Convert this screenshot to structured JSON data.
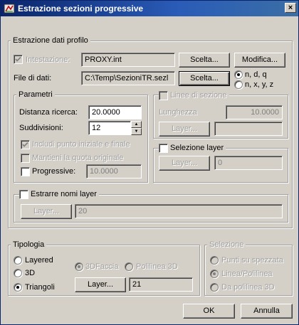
{
  "window": {
    "title": "Estrazione sezioni progressive",
    "close_glyph": "×"
  },
  "profile_group": {
    "label": "Estrazione dati profilo",
    "header_checkbox_label": "Intestazione:",
    "header_checked": true,
    "header_value": "PROXY.int",
    "header_choose_button": "Scelta...",
    "modify_button": "Modifica...",
    "data_file_label": "File di dati:",
    "data_file_value": "C:\\Temp\\SezioniTR.sezl",
    "data_file_choose_button": "Scelta...",
    "format_options": [
      {
        "label": "n, d, q",
        "selected": true
      },
      {
        "label": "n, x, y, z",
        "selected": false
      }
    ]
  },
  "params_group": {
    "label": "Parametri",
    "search_distance_label": "Distanza ricerca:",
    "search_distance_value": "20.0000",
    "subdivisions_label": "Suddivisioni:",
    "subdivisions_value": "12",
    "include_endpoints_label": "Includi punto iniziale e finale",
    "include_endpoints_checked": true,
    "keep_elevation_label": "Mantieni la quota originale",
    "keep_elevation_checked": false,
    "progressive_label": "Progressive:",
    "progressive_checked": false,
    "progressive_value": "10.0000"
  },
  "section_lines": {
    "checkbox_label": "Linee di sezione",
    "checked": false,
    "length_label": "Lunghezza",
    "length_value": "10.0000",
    "layer_button": "Layer...",
    "layer_value": ""
  },
  "layer_selection": {
    "checkbox_label": "Selezione layer",
    "checked": false,
    "layer_button": "Layer...",
    "layer_value": "0"
  },
  "extract_layer_names": {
    "checkbox_label": "Estrarre nomi layer",
    "checked": false,
    "layer_button": "Layer...",
    "layer_value": "20"
  },
  "typology_group": {
    "label": "Tipologia",
    "options": [
      {
        "label": "Layered",
        "selected": false
      },
      {
        "label": "3D",
        "selected": false
      },
      {
        "label": "Triangoli",
        "selected": true
      }
    ],
    "sub_options": [
      {
        "label": "3DFaccia",
        "selected": true
      },
      {
        "label": "Polilinea 3D",
        "selected": false
      }
    ],
    "layer_button": "Layer...",
    "layer_value": "21"
  },
  "selection_group": {
    "label": "Selezione",
    "options": [
      {
        "label": "Punti su spezzata",
        "selected": false
      },
      {
        "label": "Linea/Polilinea",
        "selected": true
      },
      {
        "label": "Da polilinea 3D",
        "selected": false
      }
    ]
  },
  "footer": {
    "ok_button": "OK",
    "cancel_button": "Annulla"
  }
}
